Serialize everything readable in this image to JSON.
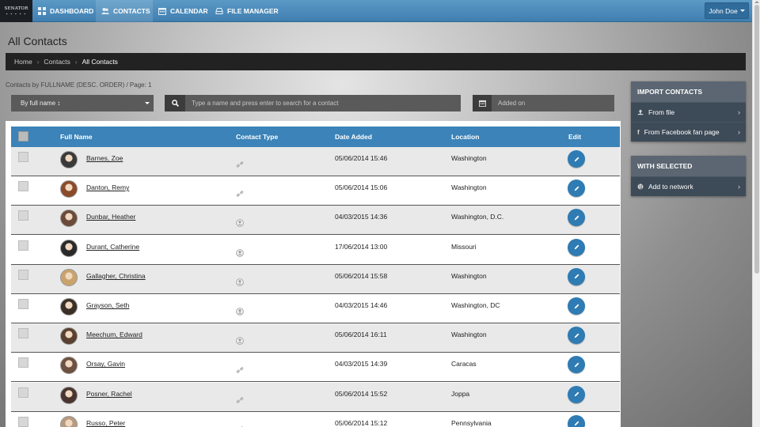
{
  "logo": {
    "text": "SENATOR",
    "dots": "• • • • •"
  },
  "nav": [
    {
      "label": "DASHBOARD",
      "icon": "grid-icon"
    },
    {
      "label": "CONTACTS",
      "icon": "users-icon"
    },
    {
      "label": "CALENDAR",
      "icon": "calendar-icon"
    },
    {
      "label": "FILE MANAGER",
      "icon": "inbox-icon"
    }
  ],
  "user": {
    "name": "John Doe"
  },
  "page_title": "All Contacts",
  "breadcrumb": {
    "home": "Home",
    "section": "Contacts",
    "current": "All Contacts"
  },
  "subtitle": "Contacts by FULLNAME (DESC. ORDER) / Page: 1",
  "sort": {
    "selected": "By full name ↕"
  },
  "search": {
    "placeholder": "Type a name and press enter to search for a contact"
  },
  "date_filter": {
    "placeholder": "Added on"
  },
  "table": {
    "headers": {
      "name": "Full Name",
      "type": "Contact Type",
      "date": "Date Added",
      "location": "Location",
      "edit": "Edit"
    },
    "rows": [
      {
        "name": "Barnes, Zoe",
        "type": "link",
        "date": "05/06/2014 15:46",
        "location": "Washington"
      },
      {
        "name": "Danton, Remy",
        "type": "link",
        "date": "05/06/2014 15:06",
        "location": "Washington"
      },
      {
        "name": "Dunbar, Heather",
        "type": "person",
        "date": "04/03/2015 14:36",
        "location": "Washington, D.C."
      },
      {
        "name": "Durant, Catherine",
        "type": "person",
        "date": "17/06/2014 13:00",
        "location": "Missouri"
      },
      {
        "name": "Gallagher, Christina",
        "type": "person",
        "date": "05/06/2014 15:58",
        "location": "Washington"
      },
      {
        "name": "Grayson, Seth",
        "type": "person",
        "date": "04/03/2015 14:46",
        "location": "Washington, DC"
      },
      {
        "name": "Meechum, Edward",
        "type": "person",
        "date": "05/06/2014 16:11",
        "location": "Washington"
      },
      {
        "name": "Orsay, Gavin",
        "type": "link",
        "date": "04/03/2015 14:39",
        "location": "Caracas"
      },
      {
        "name": "Posner, Rachel",
        "type": "link",
        "date": "05/06/2014 15:52",
        "location": "Joppa"
      },
      {
        "name": "Russo, Peter",
        "type": "link",
        "date": "05/06/2014 15:12",
        "location": "Pennsylvania"
      }
    ]
  },
  "import_panel": {
    "title": "IMPORT CONTACTS",
    "items": [
      "From file",
      "From Facebook fan page"
    ]
  },
  "selected_panel": {
    "title": "WITH SELECTED",
    "items": [
      "Add to network"
    ]
  },
  "colors": {
    "nav": "#4a8bbd",
    "header": "#3b83b8",
    "edit": "#2f7bb3",
    "panel": "#3d4a57"
  }
}
